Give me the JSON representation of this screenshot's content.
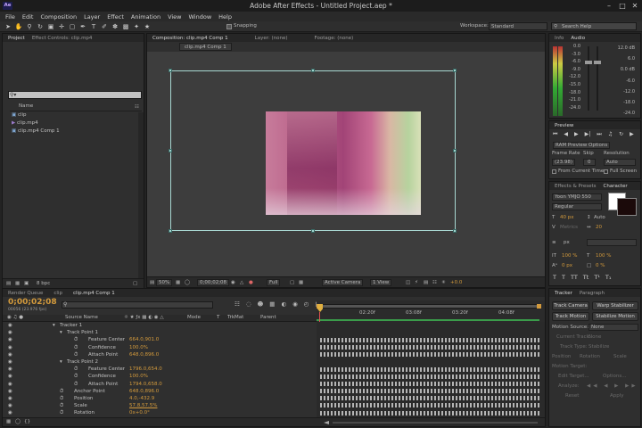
{
  "window": {
    "title": "Adobe After Effects - Untitled Project.aep *",
    "app_icon": "Ae"
  },
  "menu": [
    "File",
    "Edit",
    "Composition",
    "Layer",
    "Effect",
    "Animation",
    "View",
    "Window",
    "Help"
  ],
  "toolbar": {
    "snapping": "Snapping",
    "workspace_label": "Workspace:",
    "workspace_value": "Standard",
    "search_placeholder": "Search Help"
  },
  "project_panel": {
    "tabs": [
      "Project",
      "Effect Controls: clip.mp4"
    ],
    "search_placeholder": "",
    "column_name": "Name",
    "items": [
      "clip",
      "clip.mp4",
      "clip.mp4 Comp 1"
    ],
    "bpc": "8 bpc"
  },
  "comp_panel": {
    "tabs": [
      "Composition: clip.mp4 Comp 1",
      "Layer: (none)",
      "Footage: (none)"
    ],
    "subtab": "clip.mp4 Comp 1",
    "zoom": "50%",
    "timecode": "0;00;02;08",
    "resolution": "Full",
    "camera": "Active Camera",
    "view": "1 View",
    "exposure": "+0.0"
  },
  "info_panel": {
    "tabs": [
      "Info",
      "Audio"
    ],
    "db_right": [
      "12.0 dB",
      "6.0",
      "0.0 dB",
      "-6.0",
      "-12.0",
      "-18.0",
      "-24.0"
    ],
    "db_left": [
      "0.0",
      "-3.0",
      "-6.0",
      "-9.0",
      "-12.0",
      "-15.0",
      "-18.0",
      "-21.0",
      "-24.0"
    ]
  },
  "preview_panel": {
    "tab": "Preview",
    "ram_options": "RAM Preview Options",
    "frame_rate_label": "Frame Rate",
    "skip_label": "Skip",
    "resolution_label": "Resolution",
    "frame_rate": "(23.98)",
    "skip": "0",
    "resolution": "Auto",
    "from_current": "From Current Time",
    "full_screen": "Full Screen"
  },
  "character_panel": {
    "tabs": [
      "Effects & Presets",
      "Character"
    ],
    "font": "Yoon YMJO 550",
    "style": "Regular",
    "size": "40 px",
    "leading": "Auto",
    "kerning": "Metrics",
    "tracking": "20",
    "stroke_width": "px",
    "v_scale": "100 %",
    "h_scale": "100 %",
    "baseline": "0 px",
    "tsume": "0 %"
  },
  "tracker_panel": {
    "tabs": [
      "Tracker",
      "Paragraph"
    ],
    "track_camera": "Track Camera",
    "warp": "Warp Stabilizer",
    "track_motion": "Track Motion",
    "stabilize": "Stabilize Motion",
    "motion_source_label": "Motion Source:",
    "motion_source": "None",
    "current_track_label": "Current Track:",
    "current_track": "None",
    "track_type_label": "Track Type:",
    "track_type": "Stabilize",
    "position": "Position",
    "rotation": "Rotation",
    "scale": "Scale",
    "motion_target": "Motion Target:",
    "edit_target": "Edit Target...",
    "options": "Options...",
    "analyze": "Analyze:",
    "reset": "Reset",
    "apply": "Apply"
  },
  "timeline": {
    "tabs": [
      "Render Queue",
      "clip",
      "clip.mp4 Comp 1"
    ],
    "timecode": "0;00;02;08",
    "frame_info": "00056 (23.976 fps)",
    "columns": [
      "Source Name",
      "Mode",
      "T",
      "TrkMat",
      "Parent"
    ],
    "ruler": [
      "02:20f",
      "03:08f",
      "03:20f",
      "04:08f"
    ],
    "rows": [
      {
        "name": "Tracker 1",
        "value": ""
      },
      {
        "name": "Track Point 1",
        "value": ""
      },
      {
        "name": "Feature Center",
        "value": "664.0,901.0"
      },
      {
        "name": "Confidence",
        "value": "100.0%"
      },
      {
        "name": "Attach Point",
        "value": "648.0,896.0"
      },
      {
        "name": "Track Point 2",
        "value": ""
      },
      {
        "name": "Feature Center",
        "value": "1796.0,654.0"
      },
      {
        "name": "Confidence",
        "value": "100.0%"
      },
      {
        "name": "Attach Point",
        "value": "1794.0,658.0"
      },
      {
        "name": "Anchor Point",
        "value": "648.0,896.0"
      },
      {
        "name": "Position",
        "value": "4.0,-432.9"
      },
      {
        "name": "Scale",
        "value": "57.8,57.5%"
      },
      {
        "name": "Rotation",
        "value": "0x+0.0°"
      }
    ]
  }
}
